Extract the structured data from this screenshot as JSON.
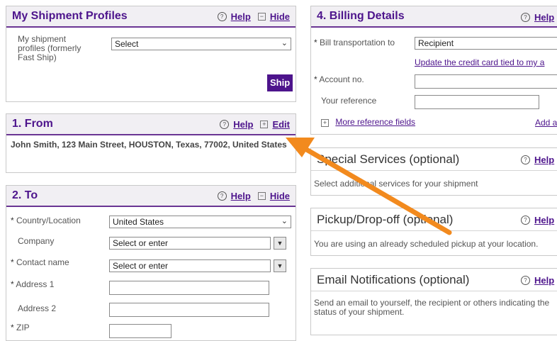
{
  "profiles": {
    "title": "My Shipment Profiles",
    "help": "Help",
    "hide": "Hide",
    "label": "My shipment profiles (formerly Fast Ship)",
    "select_value": "Select",
    "ship_button": "Ship"
  },
  "from": {
    "title": "1. From",
    "help": "Help",
    "edit": "Edit",
    "address": "John Smith, 123 Main Street, HOUSTON, Texas, 77002, United States"
  },
  "to": {
    "title": "2. To",
    "help": "Help",
    "hide": "Hide",
    "country_label": "Country/Location",
    "country_value": "United States",
    "company_label": "Company",
    "company_value": "Select or enter",
    "contact_label": "Contact name",
    "contact_value": "Select or enter",
    "address1_label": "Address 1",
    "address2_label": "Address 2",
    "zip_label": "ZIP",
    "req_mark": "*"
  },
  "billing": {
    "title": "4. Billing Details",
    "help": "Help",
    "bill_label": "Bill transportation to",
    "bill_value": "Recipient",
    "update_link": "Update the credit card tied to my a",
    "account_label": "Account no.",
    "reference_label": "Your reference",
    "more_ref_link": "More reference fields",
    "add_link": "Add a",
    "req_mark": "*"
  },
  "special": {
    "title": "Special Services (optional)",
    "help": "Help",
    "text": "Select additional services for your shipment"
  },
  "pickup": {
    "title": "Pickup/Drop-off (optional)",
    "help": "Help",
    "text": "You are using an already scheduled pickup at your location."
  },
  "email": {
    "title": "Email Notifications (optional)",
    "help": "Help",
    "text": "Send an email to yourself, the recipient or others indicating the status of your shipment."
  },
  "colors": {
    "brand_purple": "#4d148c",
    "arrow_orange": "#f28a1e"
  }
}
